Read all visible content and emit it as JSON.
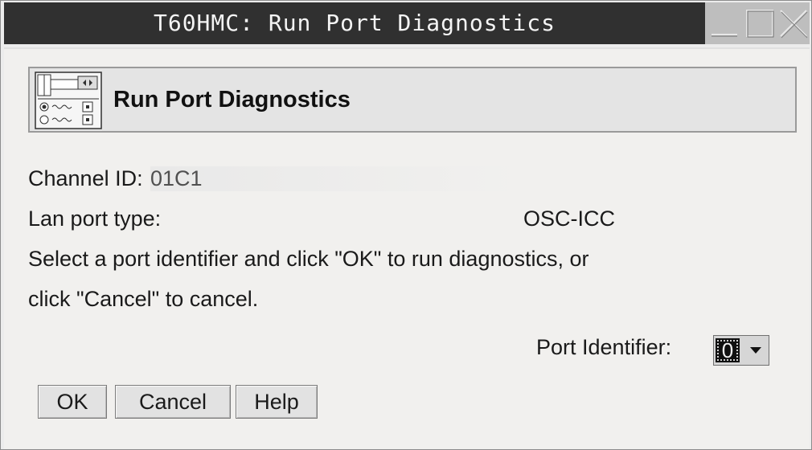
{
  "window": {
    "title": "T60HMC: Run Port Diagnostics"
  },
  "header": {
    "title": "Run Port Diagnostics",
    "icon": "ports-panel-icon"
  },
  "details": {
    "channel_id_label": "Channel ID:",
    "channel_id_value": "01C1",
    "lan_port_type_label": "Lan port type:",
    "lan_port_type_value": "OSC-ICC"
  },
  "instructions": {
    "line1": "Select a port identifier and click \"OK\" to run diagnostics, or",
    "line2": "click \"Cancel\" to cancel."
  },
  "port_identifier": {
    "label": "Port Identifier:",
    "selected": "0"
  },
  "buttons": {
    "ok": "OK",
    "cancel": "Cancel",
    "help": "Help"
  },
  "colors": {
    "title_bar": "#303030",
    "panel": "#e4e4e4",
    "background": "#f1f0ee"
  }
}
